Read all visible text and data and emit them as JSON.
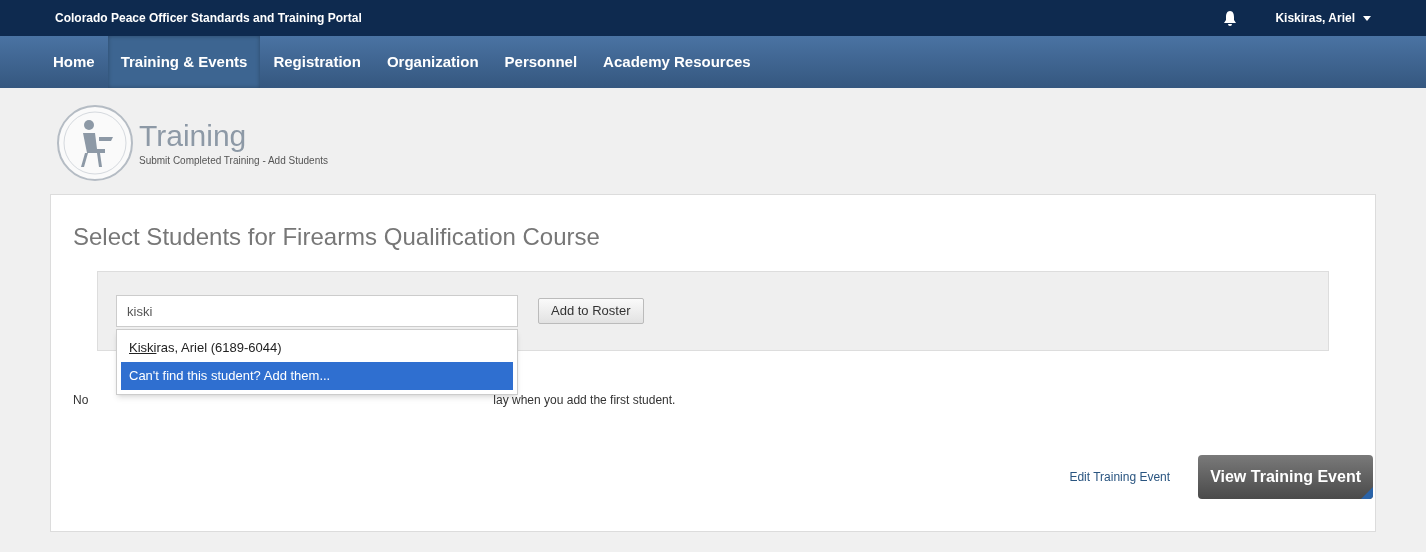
{
  "top_bar": {
    "title": "Colorado Peace Officer Standards and Training Portal",
    "user": "Kiskiras, Ariel"
  },
  "nav": [
    {
      "label": "Home",
      "selected": false
    },
    {
      "label": "Training & Events",
      "selected": true
    },
    {
      "label": "Registration",
      "selected": false
    },
    {
      "label": "Organization",
      "selected": false
    },
    {
      "label": "Personnel",
      "selected": false
    },
    {
      "label": "Academy Resources",
      "selected": false
    }
  ],
  "header": {
    "title": "Training",
    "subtitle": "Submit Completed Training - Add Students"
  },
  "card": {
    "title": "Select Students for Firearms Qualification Course",
    "search": {
      "value": "kiski"
    },
    "add_button": "Add to Roster",
    "suggestions": [
      {
        "kind": "match",
        "match": "Kiski",
        "rest": "ras, Ariel (6189-6044)",
        "selected": false
      },
      {
        "kind": "action",
        "rest": "Can't find this student? Add them...",
        "selected": true
      }
    ],
    "notice_start": "No",
    "notice_end": "lay when you add the first student.",
    "edit_link": "Edit Training Event",
    "view_button": "View Training Event"
  }
}
